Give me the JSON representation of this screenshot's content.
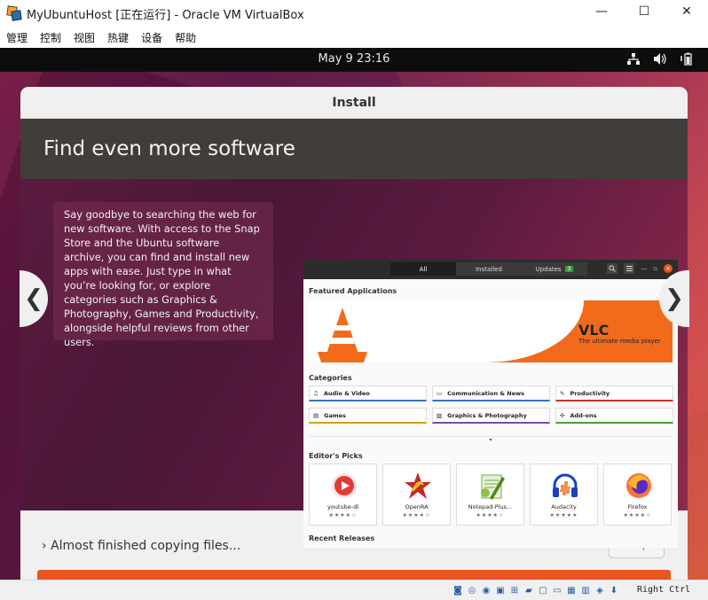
{
  "window": {
    "title": "MyUbuntuHost [正在运行] - Oracle VM VirtualBox",
    "minimize": "—",
    "maximize": "☐",
    "close": "✕"
  },
  "menu": [
    "管理",
    "控制",
    "视图",
    "热键",
    "设备",
    "帮助"
  ],
  "topbar": {
    "clock": "May 9  23:16"
  },
  "installer": {
    "header": "Install",
    "slide_title": "Find even more software",
    "slide_text": "Say goodbye to searching the web for new software. With access to the Snap Store and the Ubuntu software archive, you can find and install new apps with ease. Just type in what you’re looking for, or explore categories such as Graphics & Photography, Games and Productivity, alongside helpful reviews from other users.",
    "prev_arrow": "❮",
    "next_arrow": "❯",
    "status_text": "Almost finished copying files...",
    "status_chevron": "›",
    "skip_label": "Skip",
    "progress": 1.0
  },
  "store": {
    "tabs": [
      "All",
      "Installed",
      "Updates"
    ],
    "updates_count": "3",
    "featured_heading": "Featured Applications",
    "featured_name": "VLC",
    "featured_tagline": "The ultimate media player",
    "categories_heading": "Categories",
    "categories": [
      {
        "label": "Audio & Video",
        "icon": "music-note-icon",
        "glyph": "♫",
        "color": "#3b6fbf"
      },
      {
        "label": "Communication & News",
        "icon": "chat-icon",
        "glyph": "▭",
        "color": "#3b6fbf"
      },
      {
        "label": "Productivity",
        "icon": "pencil-icon",
        "glyph": "✎",
        "color": "#c9302c"
      },
      {
        "label": "Games",
        "icon": "gamepad-icon",
        "glyph": "▤",
        "color": "#d4a017"
      },
      {
        "label": "Graphics & Photography",
        "icon": "image-icon",
        "glyph": "▨",
        "color": "#7b4ba8"
      },
      {
        "label": "Add-ons",
        "icon": "puzzle-icon",
        "glyph": "✣",
        "color": "#4a9d3a"
      }
    ],
    "editors_heading": "Editor's Picks",
    "picks": [
      {
        "name": "youtube-dl",
        "stars": "★★★★☆"
      },
      {
        "name": "OpenRA",
        "stars": "★★★★☆"
      },
      {
        "name": "Notepad-Plus...",
        "stars": "★★★★☆"
      },
      {
        "name": "Audacity",
        "stars": "★★★★★"
      },
      {
        "name": "Firefox",
        "stars": "★★★★☆"
      }
    ],
    "recent_heading": "Recent Releases"
  },
  "vbox_status": {
    "host_key": "Right Ctrl"
  },
  "colors": {
    "ubuntu_orange": "#e95420",
    "installer_dark": "#403d3a"
  }
}
